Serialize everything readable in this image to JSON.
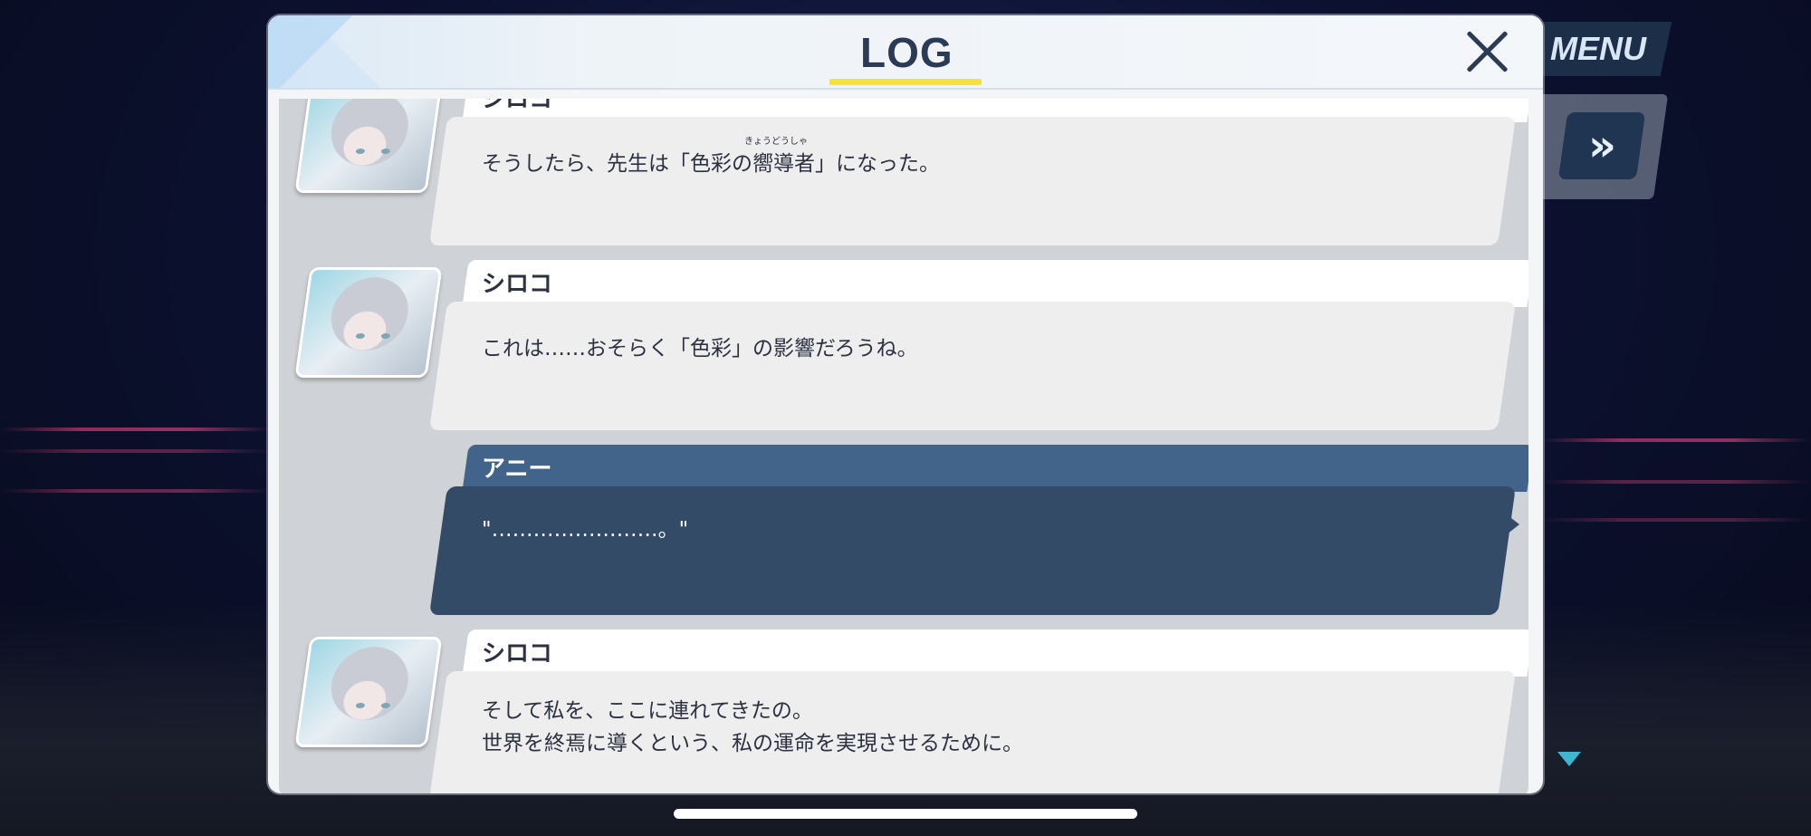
{
  "game": {
    "menu_label": "MENU",
    "fast_forward_icon": "double-chevron-right-icon",
    "next_indicator_icon": "triangle-down-icon"
  },
  "log_panel": {
    "title": "LOG",
    "close_icon": "close-x-icon",
    "entries": [
      {
        "speaker": "シロコ",
        "has_portrait": true,
        "lines": [
          "そうしたら、先生は「色彩の嚮導者」になった。"
        ],
        "ruby": "きょうどうしゃ"
      },
      {
        "speaker": "シロコ",
        "has_portrait": true,
        "lines": [
          "これは……おそらく「色彩」の影響だろうね。"
        ]
      },
      {
        "speaker": "アニー",
        "has_portrait": false,
        "highlighted": true,
        "lines": [
          "\"……………………。\""
        ]
      },
      {
        "speaker": "シロコ",
        "has_portrait": true,
        "lines": [
          "そして私を、ここに連れてきたの。",
          "世界を終焉に導くという、私の運命を実現させるために。"
        ]
      }
    ]
  },
  "colors": {
    "accent_yellow": "#f2e23a",
    "title_text": "#2b3b55",
    "highlight_box": "#344b67",
    "highlight_tab": "#42648a",
    "neon_streak": "#ff4682"
  }
}
